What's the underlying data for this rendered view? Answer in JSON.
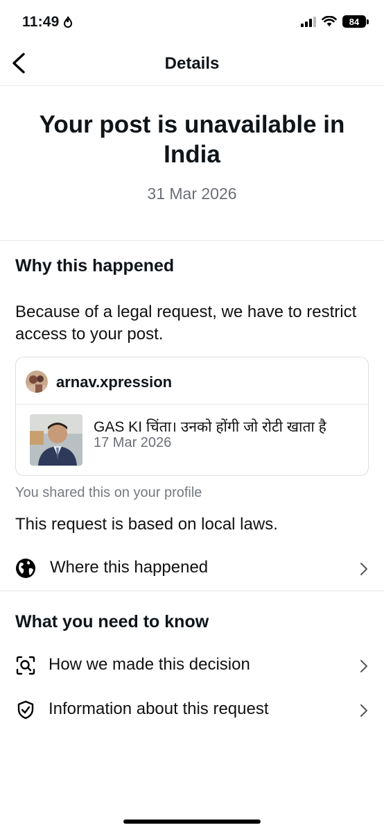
{
  "status_bar": {
    "time": "11:49",
    "battery": "84"
  },
  "nav": {
    "title": "Details"
  },
  "hero": {
    "title": "Your post is unavailable in India",
    "date": "31 Mar 2026"
  },
  "why": {
    "heading": "Why this happened",
    "description": "Because of a legal request, we have to restrict access to your post.",
    "post": {
      "username": "arnav.xpression",
      "caption": "GAS KI चिंता। उनको होंगी जो रोटी खाता है",
      "date": "17 Mar 2026"
    },
    "shared_note": "You shared this on your profile",
    "law_note": "This request is based on local laws.",
    "where_label": "Where this happened"
  },
  "know": {
    "heading": "What you need to know",
    "items": [
      {
        "label": "How we made this decision",
        "icon": "search-scan-icon"
      },
      {
        "label": "Information about this request",
        "icon": "shield-check-icon"
      }
    ]
  }
}
